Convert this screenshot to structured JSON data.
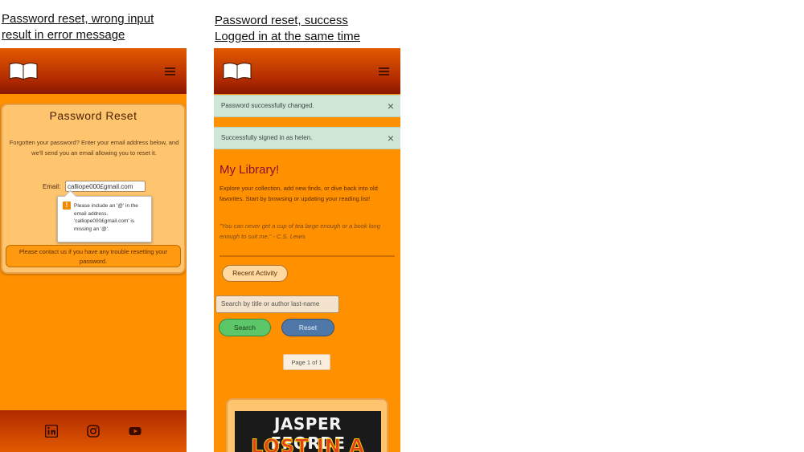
{
  "captions": {
    "left": [
      "Password reset, wrong input",
      "result in  error message"
    ],
    "right": [
      "Password reset, success",
      "Logged in at the same time"
    ]
  },
  "left_phone": {
    "title": "Password Reset",
    "description": "Forgotten your password? Enter your email address below, and we'll send you an email allowing you to reset it.",
    "email_label": "Email:",
    "email_value": "calliope000£gmail.com",
    "tooltip_text": "Please include an '@' in the email address. 'calliope000£gmail.com' is missing an '@'.",
    "contact_text": "Please contact us if you have any trouble resetting your password.",
    "footer_icons": [
      "linkedin-icon",
      "instagram-icon",
      "youtube-icon"
    ]
  },
  "right_phone": {
    "alerts": [
      "Password successfully changed.",
      "Successfully signed in as helen."
    ],
    "alert_close": "×",
    "library_title": "My Library!",
    "library_text": "Explore your collection, add new finds, or dive back into old favorites. Start by browsing or updating your reading list!",
    "library_quote": "\"You can never get a cup of tea large enough or a book long enough to suit me.\" - C.S. Lewis",
    "recent_activity_label": "Recent Activity",
    "search_placeholder": "Search by title or author last-name",
    "search_label": "Search",
    "reset_label": "Reset",
    "page_indicator": "Page 1 of 1",
    "book_cover": {
      "author": "JASPER FFORDE",
      "title": "LOST IN A"
    }
  },
  "colors": {
    "accent": "#ff9100",
    "header": "#b02a00",
    "search_btn": "#5cc768",
    "reset_btn": "#4f78a8"
  }
}
